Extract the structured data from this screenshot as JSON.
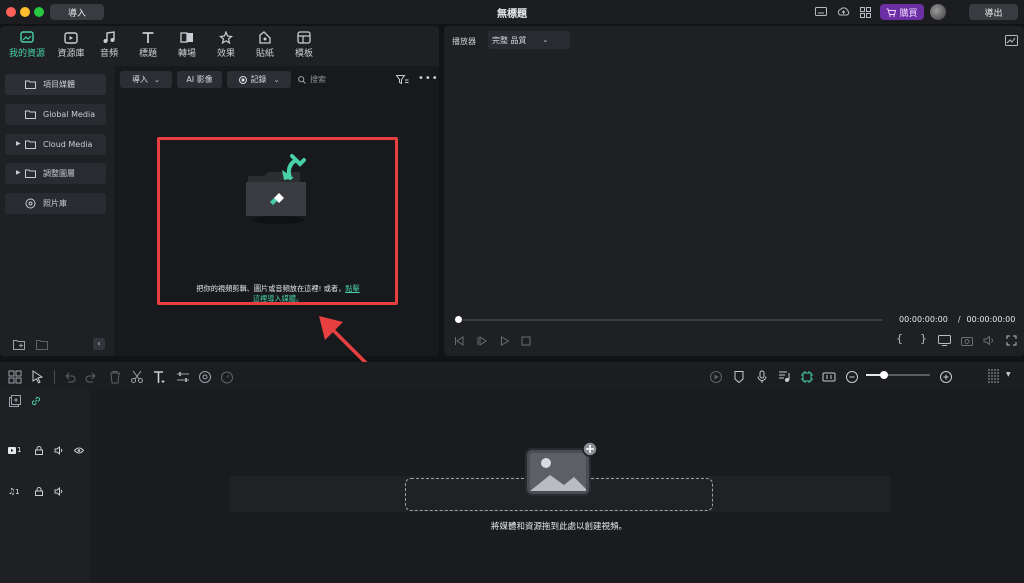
{
  "titlebar": {
    "import_label": "導入",
    "title": "無標題",
    "buy_label": "購買",
    "export_label": "導出"
  },
  "nav": {
    "items": [
      {
        "label": "我的資源",
        "icon": "my-media-icon"
      },
      {
        "label": "資源庫",
        "icon": "stock-media-icon"
      },
      {
        "label": "音頻",
        "icon": "music-note-icon"
      },
      {
        "label": "標題",
        "icon": "text-title-icon"
      },
      {
        "label": "轉場",
        "icon": "transition-icon"
      },
      {
        "label": "效果",
        "icon": "effects-star-icon"
      },
      {
        "label": "貼紙",
        "icon": "sticker-icon"
      },
      {
        "label": "模板",
        "icon": "template-icon"
      }
    ]
  },
  "sidebar": {
    "items": [
      {
        "label": "項目媒體"
      },
      {
        "label": "Global Media"
      },
      {
        "label": "Cloud Media"
      },
      {
        "label": "調整圖層"
      },
      {
        "label": "照片庫"
      }
    ]
  },
  "media": {
    "import_label": "導入",
    "ai_image_label": "AI 影像",
    "record_label": "記錄",
    "search_placeholder": "搜索",
    "drop_text": "把你的視頻剪輯、圖片或音頻放在這裡! 或者，",
    "drop_link_1": "點擊",
    "drop_link_2": "這裡導入媒體。"
  },
  "preview": {
    "player_label": "播放器",
    "quality_label": "完整 品質",
    "current_time": "00:00:00:00",
    "separator": "/",
    "total_time": "00:00:00:00",
    "progress": 0
  },
  "timeline": {
    "video_track_num": "1",
    "audio_track_num": "1",
    "zoom_level": 0.12,
    "drop_hint": "將媒體和資源拖到此處以創建視頻。"
  },
  "colors": {
    "accent": "#48d1a9",
    "annotation_red": "#e84040",
    "buy_purple": "#6b2fa3"
  }
}
